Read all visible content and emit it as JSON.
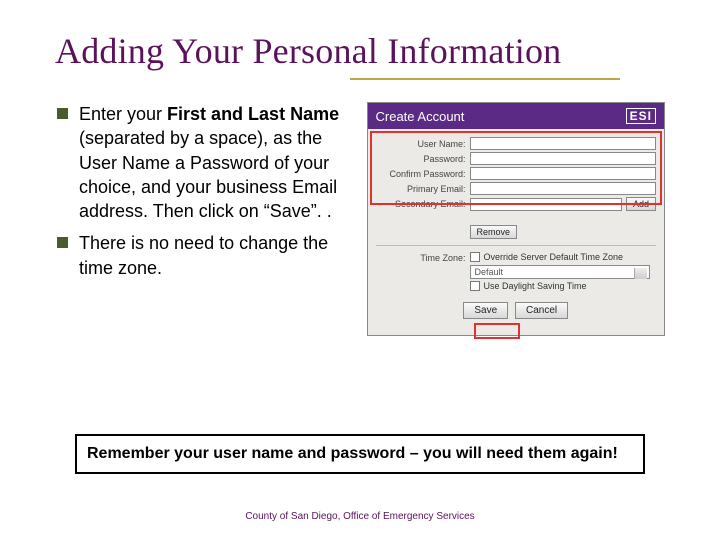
{
  "title": "Adding Your Personal Information",
  "bullets": [
    {
      "prefix": "Enter your ",
      "bold": "First and Last Name",
      "rest": " (separated by a space), as the User Name a Password of your choice, and your business Email address. Then click on “Save”. ."
    },
    {
      "prefix": "There is no need to change the time zone.",
      "bold": "",
      "rest": ""
    }
  ],
  "screenshot": {
    "header": "Create Account",
    "logo": "ESI",
    "fields": {
      "user_name": "User Name:",
      "password": "Password:",
      "confirm_password": "Confirm Password:",
      "primary_email": "Primary Email:",
      "secondary_email": "Secondary Email:",
      "time_zone": "Time Zone:"
    },
    "add_btn": "Add",
    "remove_btn": "Remove",
    "override_label": "Override Server Default Time Zone",
    "dst_label": "Use Daylight Saving Time",
    "tz_value": "Default",
    "save_btn": "Save",
    "cancel_btn": "Cancel"
  },
  "reminder": "Remember your user name and password – you will need them again!",
  "footer": "County of San Diego, Office of Emergency Services"
}
